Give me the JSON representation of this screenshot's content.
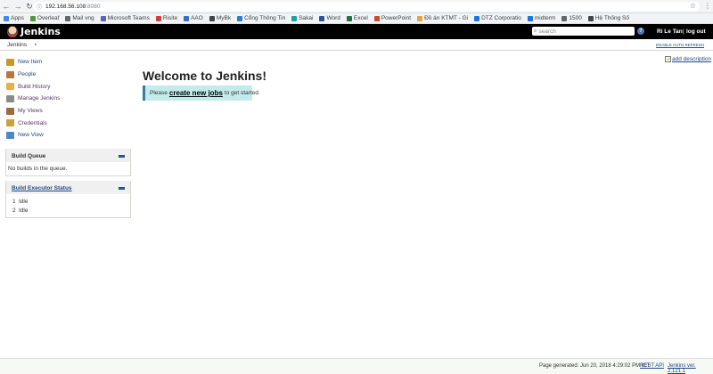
{
  "browser": {
    "url_host": "192.168.56.108",
    "url_port": ":8080",
    "bookmarks": [
      {
        "label": "Apps",
        "color": "#4285f4"
      },
      {
        "label": "Overleaf",
        "color": "#4b9a3b"
      },
      {
        "label": "Mail vng",
        "color": "#666666"
      },
      {
        "label": "Microsoft Teams",
        "color": "#5b5fc7"
      },
      {
        "label": "Risite",
        "color": "#d43c3c"
      },
      {
        "label": "AAO",
        "color": "#3b6dc4"
      },
      {
        "label": "MyBk",
        "color": "#444444"
      },
      {
        "label": "Cổng Thông Tin",
        "color": "#2e7bd6"
      },
      {
        "label": "Sakai",
        "color": "#1aa1a1"
      },
      {
        "label": "Word",
        "color": "#2b579a"
      },
      {
        "label": "Excel",
        "color": "#217346"
      },
      {
        "label": "PowerPoint",
        "color": "#d24726"
      },
      {
        "label": "Đồ án KTMT - Gi",
        "color": "#e8a33c"
      },
      {
        "label": "DTZ Corporatio",
        "color": "#1a73e8"
      },
      {
        "label": "midterm",
        "color": "#1a73e8"
      },
      {
        "label": "1500",
        "color": "#666666"
      },
      {
        "label": "Hệ Thống Số",
        "color": "#444444"
      }
    ]
  },
  "header": {
    "title": "Jenkins",
    "search_placeholder": "search",
    "help_label": "?",
    "user": "Ri Le Tan",
    "separator": "|",
    "logout": "log out"
  },
  "breadcrumb": {
    "root": "Jenkins",
    "arrow": "▸",
    "auto_refresh": "ENABLE AUTO REFRESH"
  },
  "tasks": [
    {
      "label": "New Item",
      "name": "new-item",
      "icon_color": "#c49a2c",
      "visited": false
    },
    {
      "label": "People",
      "name": "people",
      "icon_color": "#b77a3e",
      "visited": false
    },
    {
      "label": "Build History",
      "name": "build-history",
      "icon_color": "#e5b243",
      "visited": true
    },
    {
      "label": "Manage Jenkins",
      "name": "manage-jenkins",
      "icon_color": "#8a8a8a",
      "visited": true
    },
    {
      "label": "My Views",
      "name": "my-views",
      "icon_color": "#9b6b3c",
      "visited": true
    },
    {
      "label": "Credentials",
      "name": "credentials",
      "icon_color": "#c8a23a",
      "visited": true
    },
    {
      "label": "New View",
      "name": "new-view",
      "icon_color": "#4f86c6",
      "visited": false
    }
  ],
  "build_queue": {
    "title": "Build Queue",
    "empty": "No builds in the queue."
  },
  "executors": {
    "title": "Build Executor Status",
    "rows": [
      {
        "num": "1",
        "status": "Idle"
      },
      {
        "num": "2",
        "status": "Idle"
      }
    ]
  },
  "main": {
    "welcome": "Welcome to Jenkins!",
    "info_prefix": "Please",
    "info_link": "create new jobs",
    "info_suffix": "to get started.",
    "add_description": "add description"
  },
  "footer": {
    "generated": "Page generated: Jun 20, 2018 4:29:02 PM ICT",
    "rest_api": "REST API",
    "version": "Jenkins ver. 2.121.1"
  }
}
